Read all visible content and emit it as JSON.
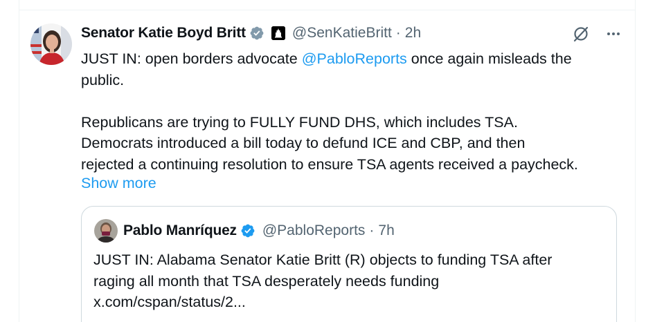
{
  "tweet": {
    "author_name": "Senator Katie Boyd Britt",
    "author_handle": "@SenKatieBritt",
    "separator": "·",
    "time": "2h",
    "badges": {
      "verified": "gov-verified-badge-icon",
      "affiliation": "capitol-affiliation-icon"
    },
    "actions": {
      "grok": "grok-icon",
      "more": "more-icon"
    },
    "text": {
      "prefix": "JUST IN: open borders advocate ",
      "mention": "@PabloReports",
      "suffix_line1": " once again misleads the",
      "line2": "public.",
      "paragraph2": [
        "Republicans are trying to FULLY FUND DHS, which includes TSA.",
        "Democrats introduced a bill today to defund ICE and CBP, and then",
        "rejected a continuing resolution to ensure TSA agents received a paycheck."
      ]
    },
    "show_more": "Show more"
  },
  "quote": {
    "author_name": "Pablo Manríquez",
    "author_handle": "@PabloReports",
    "separator": "·",
    "time": "7h",
    "verified": "verified-badge-icon",
    "text_lines": [
      "JUST IN: Alabama Senator Katie Britt (R) objects to funding TSA after",
      "raging all month that TSA desperately needs funding",
      "x.com/cspan/status/2..."
    ]
  },
  "colors": {
    "accent": "#1d9bf0",
    "gov_badge": "#829aab",
    "secondary_text": "#536471",
    "border": "#cfd9de"
  }
}
